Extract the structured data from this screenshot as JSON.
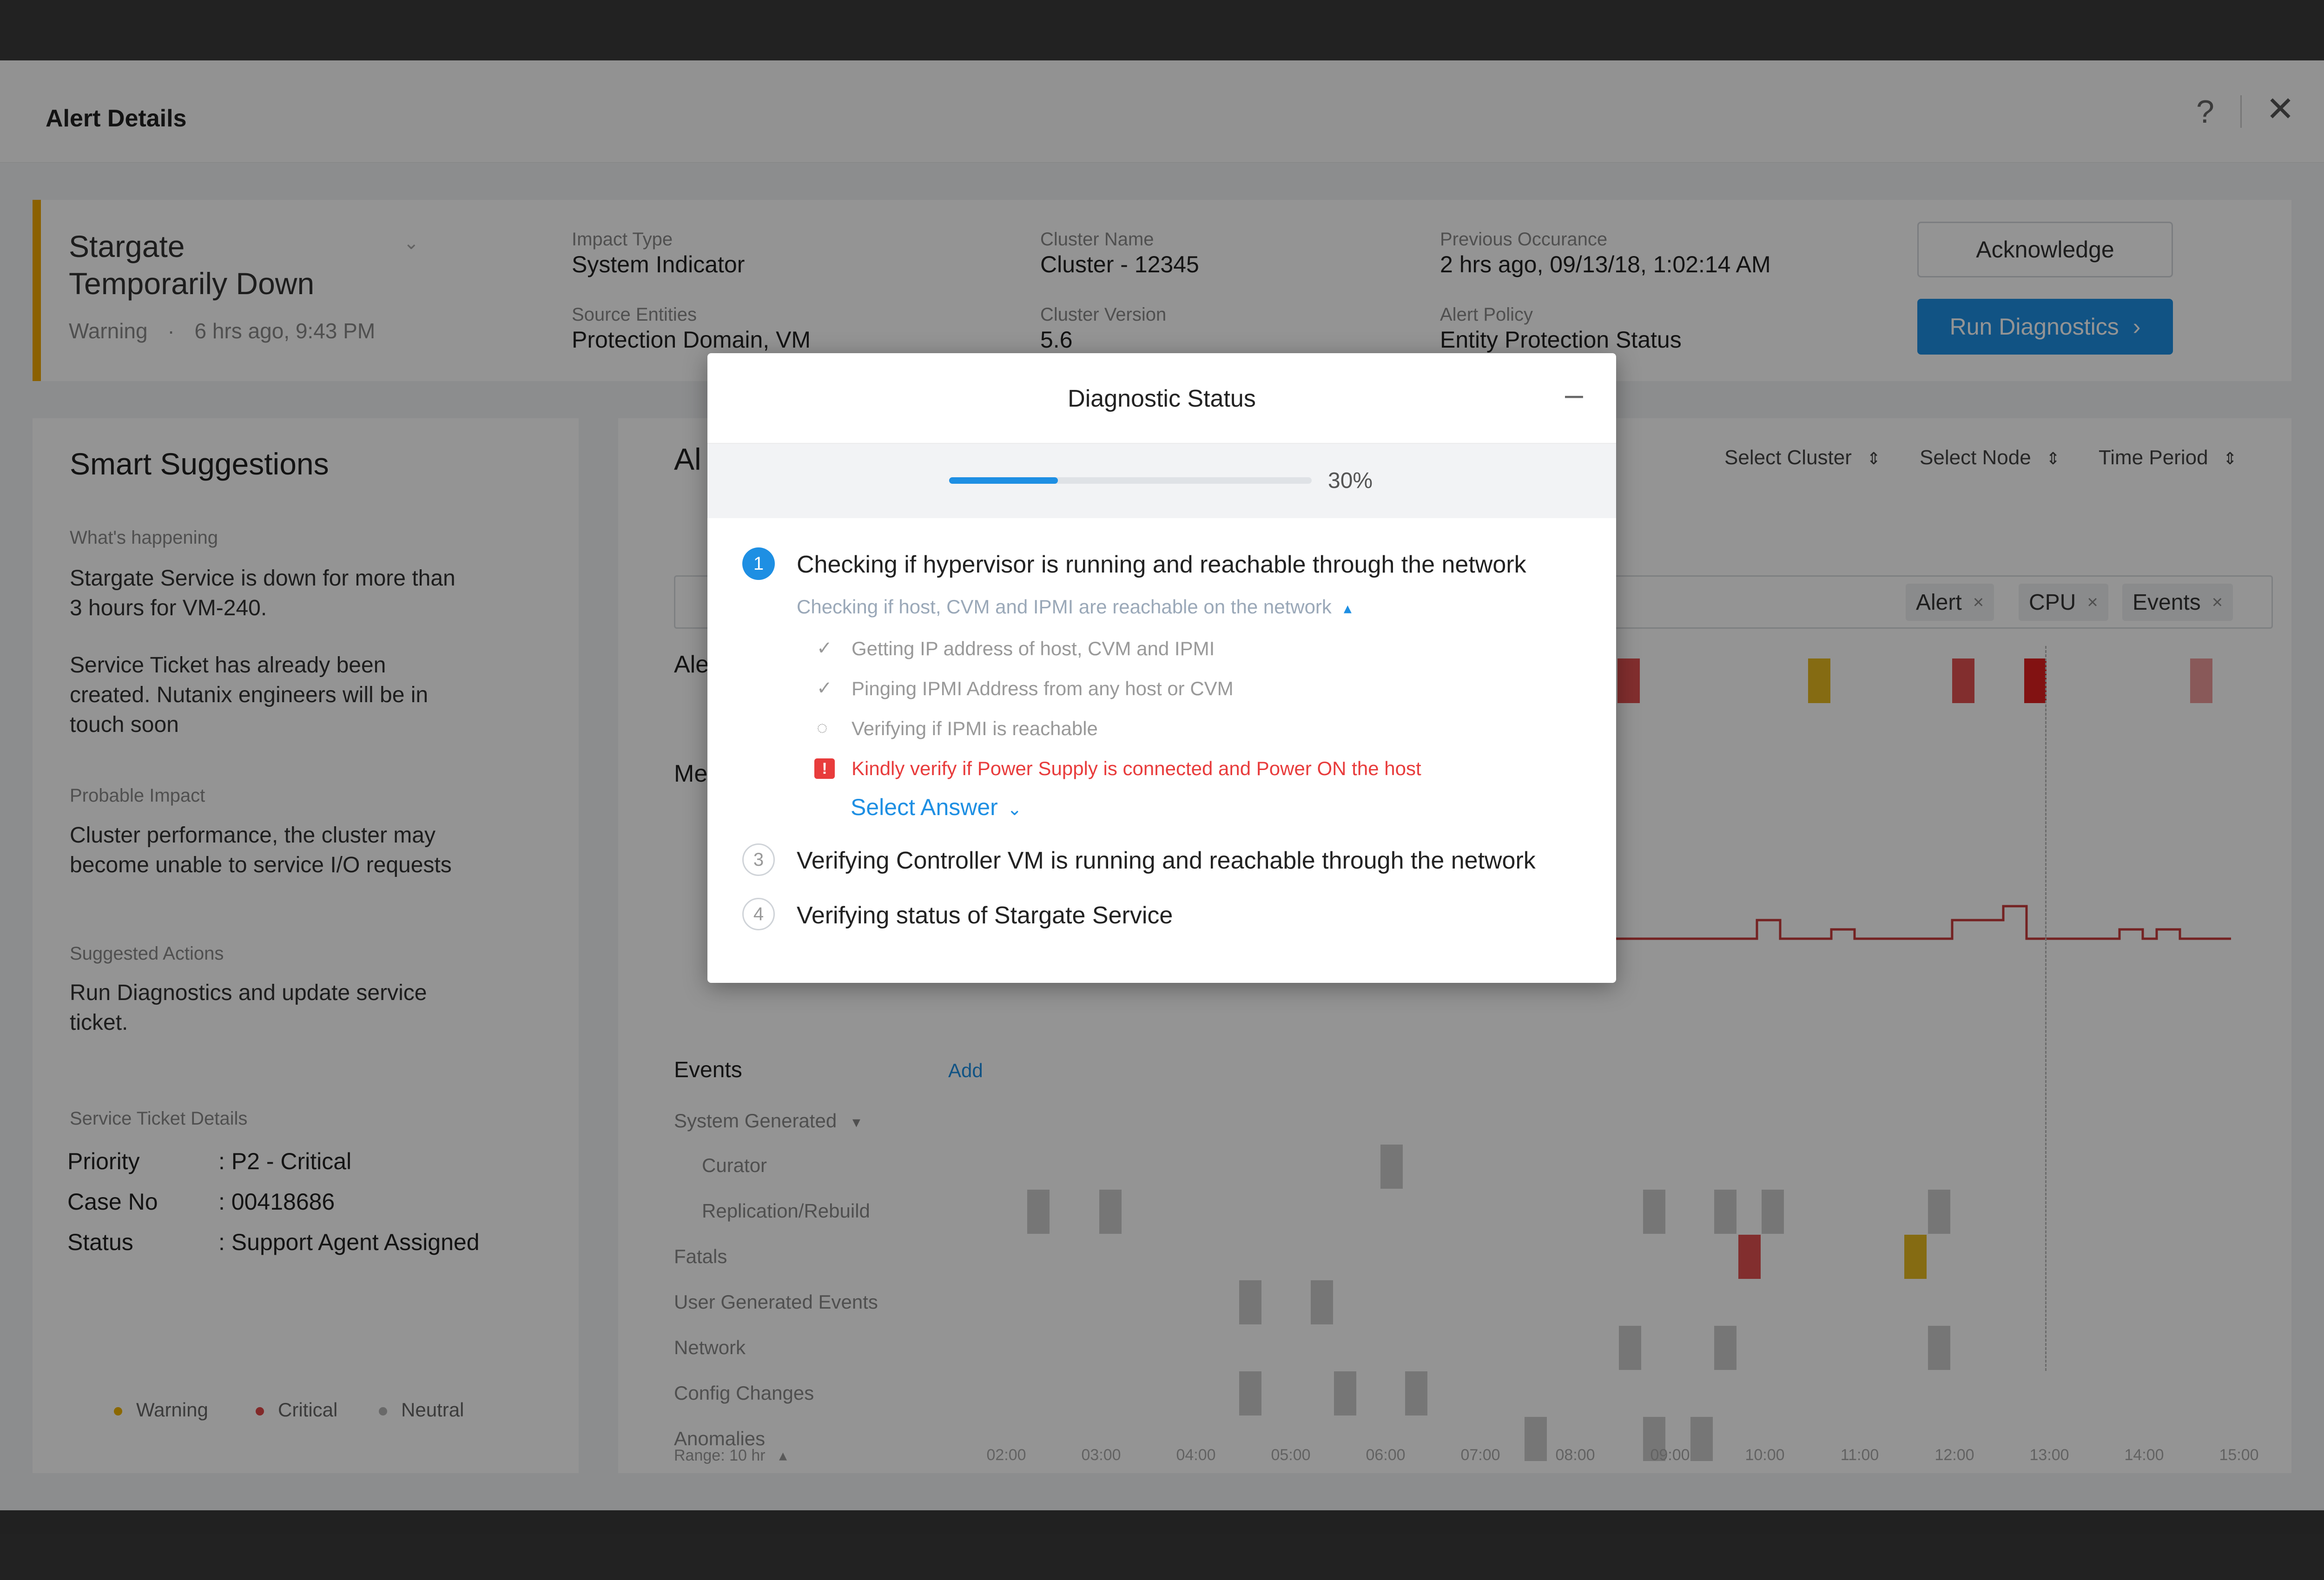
{
  "window": {
    "title": "Alert Details",
    "help": "?",
    "close": "✕"
  },
  "alert": {
    "name_line1": "Stargate",
    "name_line2": "Temporarily Down",
    "severity": "Warning",
    "sep": "·",
    "time": "6 hrs ago, 9:43 PM",
    "impact_type_label": "Impact Type",
    "impact_type": "System Indicator",
    "source_entities_label": "Source Entities",
    "source_entities": "Protection Domain, VM",
    "cluster_name_label": "Cluster Name",
    "cluster_name": "Cluster - 12345",
    "cluster_version_label": "Cluster Version",
    "cluster_version": "5.6",
    "prev_occ_label": "Previous Occurance",
    "prev_occ": "2 hrs ago, 09/13/18, 1:02:14 AM",
    "policy_label": "Alert Policy",
    "policy": "Entity Protection Status",
    "acknowledge": "Acknowledge",
    "run_diagnostics": "Run Diagnostics",
    "run_arrow": "›"
  },
  "suggestions": {
    "title": "Smart Suggestions",
    "whats_happening_label": "What's happening",
    "whats_1a": "Stargate Service is down for more than",
    "whats_1b": "3 hours for VM-240.",
    "whats_2a": "Service Ticket has already been",
    "whats_2b": "created. Nutanix engineers will be in",
    "whats_2c": "touch soon",
    "impact_label": "Probable Impact",
    "impact_a": "Cluster performance, the cluster may",
    "impact_b": "become unable to service I/O requests",
    "actions_label": "Suggested Actions",
    "actions_a": "Run Diagnostics and update service",
    "actions_b": "ticket.",
    "ticket_label": "Service Ticket Details",
    "priority_k": "Priority",
    "priority_v": ": P2 - Critical",
    "case_k": "Case No",
    "case_v": ": 00418686",
    "status_k": "Status",
    "status_v": ": Support Agent Assigned",
    "legend": [
      "Warning",
      "Critical",
      "Neutral"
    ]
  },
  "main": {
    "heading_partial": "Al",
    "row_label_1": "Ale",
    "row_label_2": "Me",
    "filters": [
      "Select Cluster",
      "Select Node",
      "Time Period"
    ],
    "filter_arrow": "⇕",
    "tags": [
      "Alert",
      "CPU",
      "Events"
    ],
    "tag_x": "×",
    "events_title": "Events",
    "add": "Add",
    "rows": [
      "System Generated",
      "Curator",
      "Replication/Rebuild",
      "Fatals",
      "User Generated Events",
      "Network",
      "Config Changes",
      "Anomalies"
    ],
    "caret": "▾",
    "range": "Range: 10 hr",
    "range_caret": "▴",
    "times": [
      "02:00",
      "03:00",
      "04:00",
      "05:00",
      "06:00",
      "07:00",
      "08:00",
      "09:00",
      "10:00",
      "11:00",
      "12:00",
      "13:00",
      "14:00",
      "15:00"
    ]
  },
  "colors": {
    "warning": "#f0b400",
    "critical": "#e04848",
    "neutral": "#b5b5b5",
    "accent": "#1e8fe3"
  },
  "modal": {
    "title": "Diagnostic Status",
    "minimize": "–",
    "progress": 0.3,
    "progress_label": "30%",
    "step1_num": "1",
    "step1": "Checking if hypervisor is running and reachable through  the network",
    "step1_sub": "Checking if host, CVM and IPMI are reachable on the network",
    "step1_sub_caret": "▴",
    "check_mark": "✓",
    "spinner": "◌",
    "sub1": "Getting IP address of host, CVM and IPMI",
    "sub2": "Pinging IPMI Address from any host or CVM",
    "sub3": "Verifying if IPMI is reachable",
    "err_icon": "!",
    "error": "Kindly verify if Power Supply is connected and Power ON the host",
    "select_answer": "Select Answer",
    "select_caret": "⌄",
    "step3_num": "3",
    "step3": "Verifying Controller VM is running and reachable through the network",
    "step4_num": "4",
    "step4": "Verifying status of Stargate Service"
  }
}
